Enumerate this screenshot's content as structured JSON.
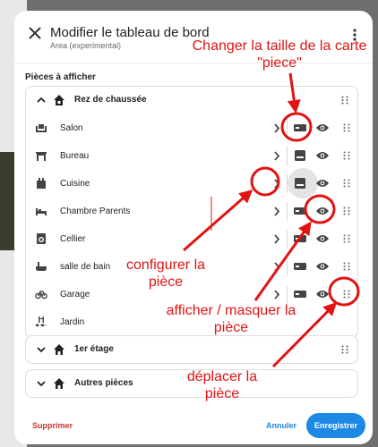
{
  "dialog": {
    "title": "Modifier le tableau de bord",
    "subtitle": "Area (experimental)",
    "section_label": "Pièces à afficher"
  },
  "floors": [
    {
      "label": "Rez de chaussée",
      "expanded": true
    },
    {
      "label": "1er étage",
      "expanded": false
    },
    {
      "label": "Autres pièces",
      "expanded": false
    }
  ],
  "rooms": [
    {
      "label": "Salon",
      "icon": "sofa-icon"
    },
    {
      "label": "Bureau",
      "icon": "desk-icon"
    },
    {
      "label": "Cuisine",
      "icon": "stove-icon"
    },
    {
      "label": "Chambre Parents",
      "icon": "bed-icon"
    },
    {
      "label": "Cellier",
      "icon": "washing-machine-icon"
    },
    {
      "label": "salle de bain",
      "icon": "bathtub-icon"
    },
    {
      "label": "Garage",
      "icon": "bicycle-icon"
    },
    {
      "label": "Jardin",
      "icon": "pool-icon"
    }
  ],
  "footer": {
    "delete_label": "Supprimer",
    "cancel_label": "Annuler",
    "save_label": "Enregistrer"
  },
  "annotations": {
    "size_card": "Changer la taille de la carte \"piece\"",
    "configure": "configurer la pièce",
    "visibility": "afficher / masquer la pièce",
    "move": "déplacer la pièce"
  },
  "colors": {
    "accent": "#1e88e5",
    "delete": "#c0392b",
    "annotation": "#e11313"
  }
}
